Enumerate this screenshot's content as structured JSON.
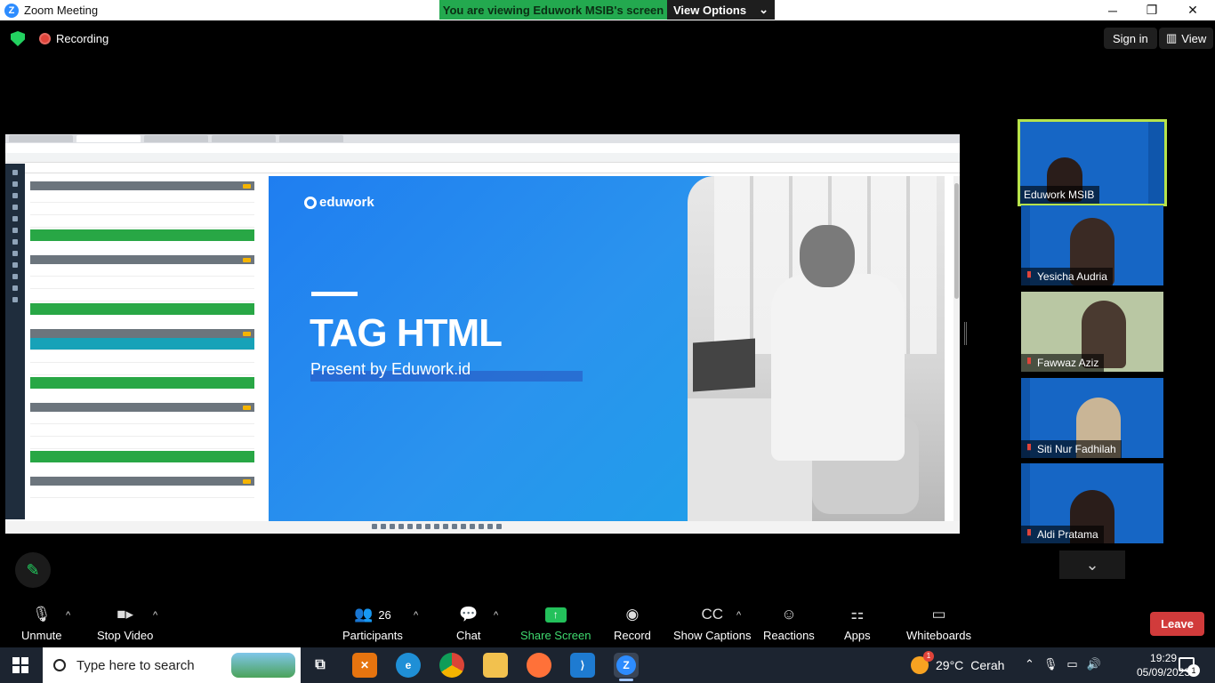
{
  "window": {
    "title": "Zoom Meeting",
    "controls": {
      "minimize": "─",
      "restore": "❐",
      "close": "✕"
    }
  },
  "banner": {
    "message": "You are viewing Eduwork MSIB's screen",
    "view_options": "View Options"
  },
  "topbar": {
    "recording": "Recording",
    "sign_in": "Sign in",
    "view": "View"
  },
  "shared_screen": {
    "slide": {
      "brand": "eduwork",
      "title": "TAG HTML",
      "subtitle": "Present by Eduwork.id"
    }
  },
  "participants_panel": [
    {
      "name": "Eduwork MSIB",
      "muted": false,
      "active": true
    },
    {
      "name": "Yesicha Audria",
      "muted": true,
      "active": false
    },
    {
      "name": "Fawwaz Aziz",
      "muted": true,
      "active": false
    },
    {
      "name": "Siti Nur Fadhilah",
      "muted": true,
      "active": false
    },
    {
      "name": "Aldi Pratama",
      "muted": true,
      "active": false
    }
  ],
  "toolbar": {
    "unmute": "Unmute",
    "stop_video": "Stop Video",
    "participants": "Participants",
    "participants_count": "26",
    "chat": "Chat",
    "share_screen": "Share Screen",
    "record": "Record",
    "show_captions": "Show Captions",
    "captions_icon": "CC",
    "reactions": "Reactions",
    "apps": "Apps",
    "whiteboards": "Whiteboards",
    "leave": "Leave"
  },
  "taskbar": {
    "search_placeholder": "Type here to search",
    "weather_temp": "29°C",
    "weather_desc": "Cerah",
    "weather_badge": "1",
    "time": "19:29",
    "date": "05/09/2023",
    "notification_count": "1"
  }
}
